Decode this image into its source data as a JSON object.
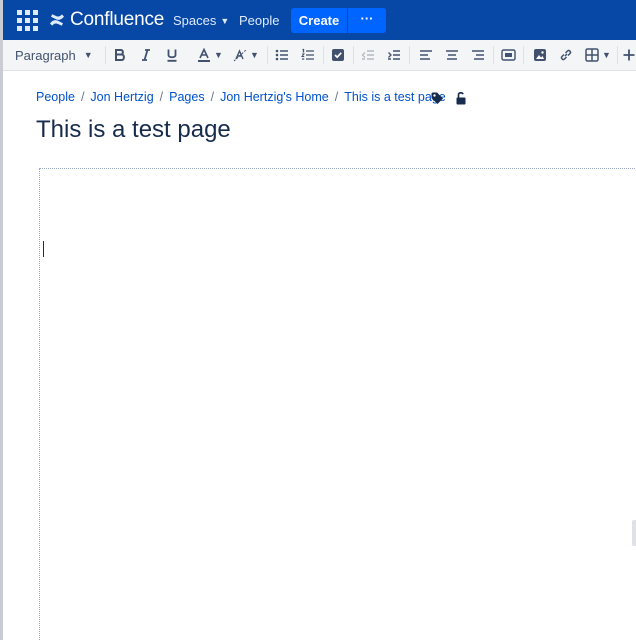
{
  "header": {
    "app_name": "Confluence",
    "nav": {
      "spaces_label": "Spaces",
      "people_label": "People"
    },
    "create_label": "Create",
    "more_label": "···"
  },
  "toolbar": {
    "paragraph_label": "Paragraph"
  },
  "breadcrumb": {
    "items": [
      "People",
      "Jon Hertzig",
      "Pages",
      "Jon Hertzig's Home",
      "This is a test page"
    ]
  },
  "page": {
    "title": "This is a test page"
  },
  "colors": {
    "header_bg": "#0747a6",
    "create_bg": "#0065ff",
    "link": "#0052cc",
    "toolbar_bg": "#f4f5f7"
  },
  "icons": [
    "apps-grid-icon",
    "confluence-logo-icon",
    "bold-icon",
    "italic-icon",
    "underline-icon",
    "text-color-icon",
    "text-style-icon",
    "bullet-list-icon",
    "numbered-list-icon",
    "task-list-icon",
    "outdent-icon",
    "indent-icon",
    "align-left-icon",
    "align-center-icon",
    "align-right-icon",
    "page-layout-icon",
    "image-icon",
    "link-icon",
    "table-icon",
    "insert-more-icon",
    "label-icon",
    "restrictions-unlocked-icon"
  ]
}
